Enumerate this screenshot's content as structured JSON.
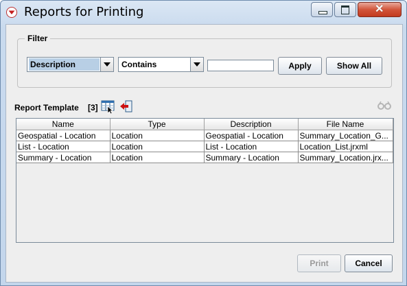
{
  "window": {
    "title": "Reports for Printing"
  },
  "filter": {
    "legend": "Filter",
    "field_value": "Description",
    "operator_value": "Contains",
    "search_value": "",
    "apply_label": "Apply",
    "show_all_label": "Show All"
  },
  "templates": {
    "label": "Report Template",
    "count": "[3]",
    "columns": [
      "Name",
      "Type",
      "Description",
      "File Name"
    ],
    "rows": [
      [
        "Geospatial - Location",
        "Location",
        "Geospatial - Location",
        "Summary_Location_G..."
      ],
      [
        "List - Location",
        "Location",
        "List - Location",
        "Location_List.jrxml"
      ],
      [
        "Summary - Location",
        "Location",
        "Summary - Location",
        "Summary_Location.jrx..."
      ]
    ]
  },
  "footer": {
    "print_label": "Print",
    "cancel_label": "Cancel"
  },
  "icons": {
    "app": "app-logo-icon",
    "table_view": "table-view-icon",
    "back": "back-arrow-icon",
    "glasses": "glasses-icon"
  },
  "colors": {
    "selection": "#b8cfe5",
    "close_button": "#d2553b",
    "back_arrow": "#cc1111"
  }
}
